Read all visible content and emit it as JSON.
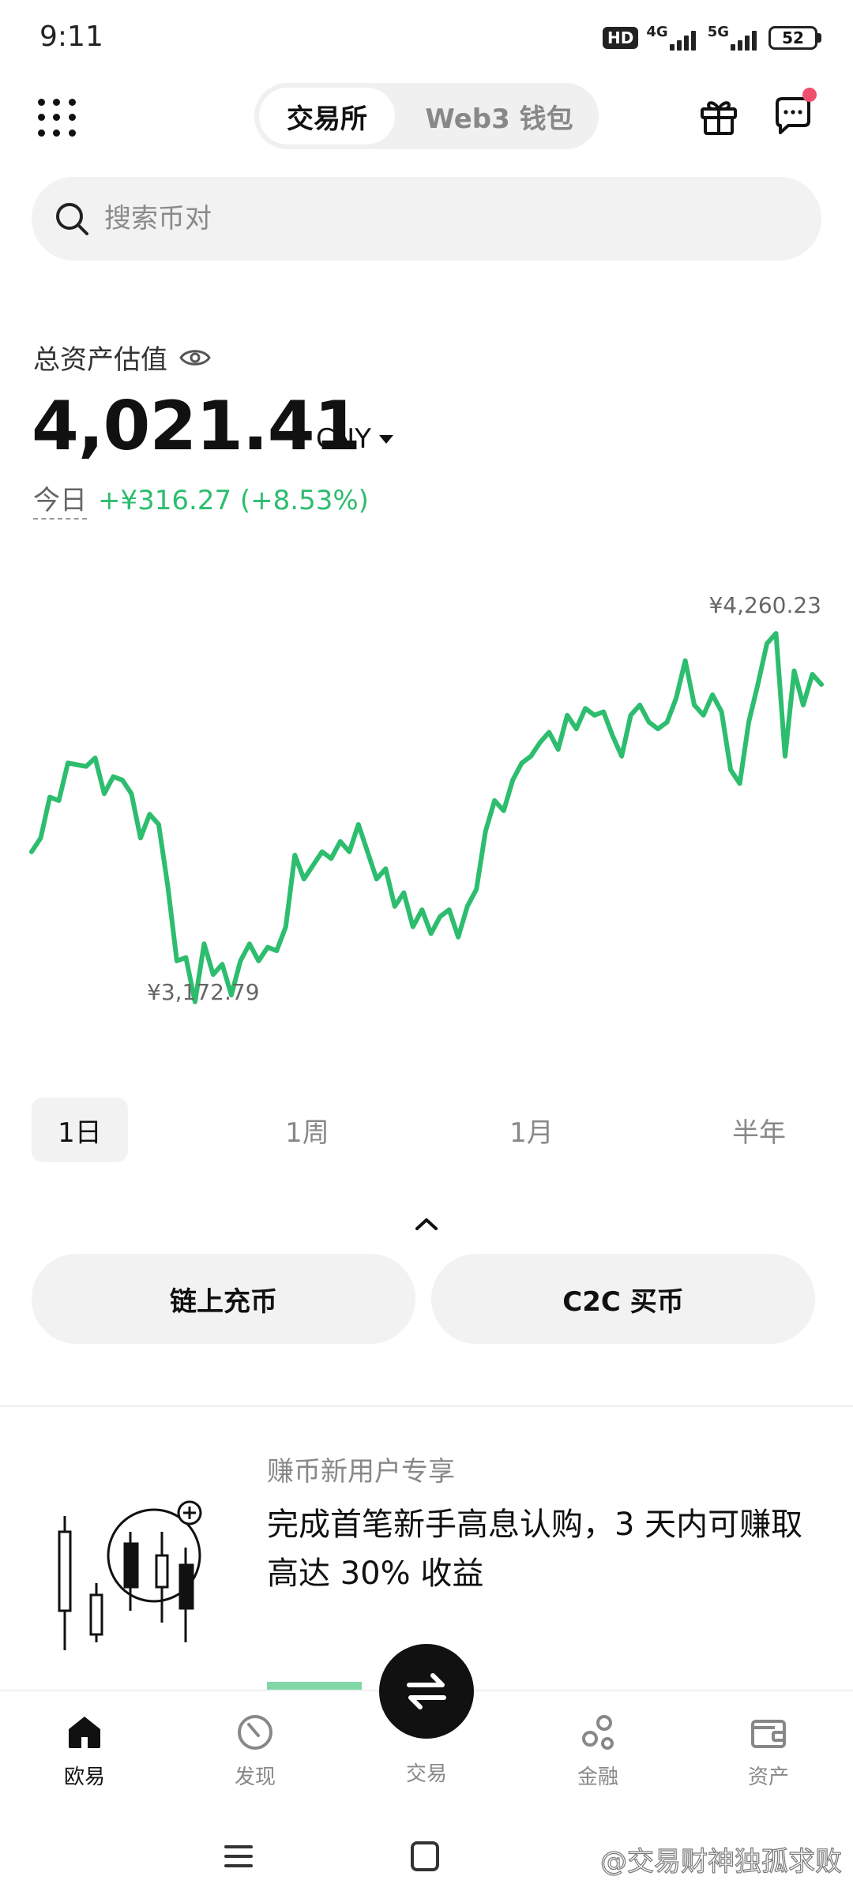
{
  "status_bar": {
    "time": "9:11",
    "hd": "HD",
    "net1": "4G",
    "net2": "5G",
    "battery": "52"
  },
  "header": {
    "tab_exchange": "交易所",
    "tab_wallet": "Web3 钱包",
    "menu_icon": "grid-icon",
    "gift_icon": "gift-icon",
    "chat_icon": "chat-icon",
    "notification_color": "#f0506e"
  },
  "search": {
    "placeholder": "搜索币对"
  },
  "assets": {
    "label": "总资产估值",
    "value": "4,021.41",
    "currency": "CNY",
    "today_label": "今日",
    "today_change": "+¥316.27 (+8.53%)"
  },
  "chart_data": {
    "type": "line",
    "color": "#2dbd6e",
    "max_label": "¥4,260.23",
    "min_label": "¥3,172.79",
    "ylim": [
      3172.79,
      4260.23
    ],
    "values": [
      3620,
      3660,
      3780,
      3770,
      3880,
      3875,
      3870,
      3895,
      3790,
      3840,
      3830,
      3790,
      3660,
      3730,
      3700,
      3520,
      3300,
      3310,
      3180,
      3350,
      3260,
      3290,
      3200,
      3300,
      3350,
      3300,
      3340,
      3330,
      3400,
      3610,
      3540,
      3580,
      3620,
      3600,
      3650,
      3620,
      3700,
      3620,
      3540,
      3570,
      3460,
      3500,
      3400,
      3450,
      3380,
      3430,
      3450,
      3370,
      3460,
      3510,
      3680,
      3770,
      3740,
      3830,
      3880,
      3900,
      3940,
      3970,
      3920,
      4020,
      3980,
      4040,
      4020,
      4030,
      3960,
      3900,
      4020,
      4050,
      4000,
      3980,
      4000,
      4070,
      4180,
      4050,
      4020,
      4080,
      4030,
      3860,
      3820,
      4000,
      4110,
      4230,
      4260,
      3900,
      4150,
      4050,
      4140,
      4110
    ]
  },
  "ranges": [
    "1日",
    "1周",
    "1月",
    "半年"
  ],
  "actions": {
    "deposit": "链上充币",
    "c2c": "C2C 买币"
  },
  "promo": {
    "subtitle": "赚币新用户专享",
    "title": "完成首笔新手高息认购，3 天内可赚取高达 30% 收益"
  },
  "bottom_nav": {
    "home": "欧易",
    "discover": "发现",
    "trade": "交易",
    "finance": "金融",
    "assets": "资产"
  },
  "watermark": "@交易财神独孤求败"
}
